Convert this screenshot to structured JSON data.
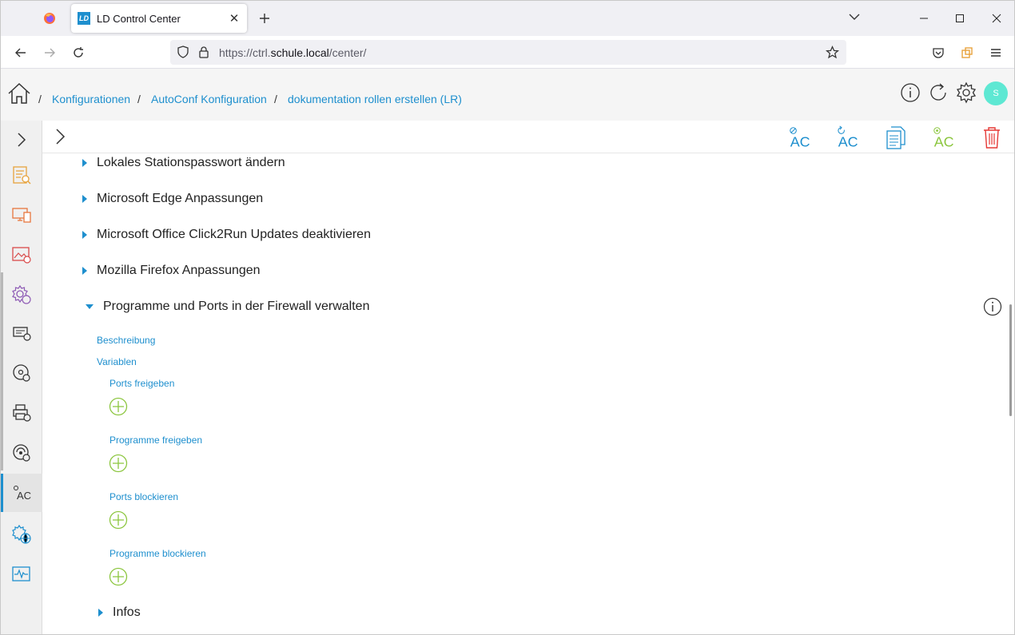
{
  "browser": {
    "tab_title": "LD Control Center",
    "tab_logo": "LD",
    "url_prefix": "https://ctrl.",
    "url_host": "schule.local",
    "url_path": "/center/"
  },
  "breadcrumb": [
    {
      "label": "Konfigurationen"
    },
    {
      "label": "AutoConf Konfiguration"
    },
    {
      "label": "dokumentation rollen erstellen (LR)"
    }
  ],
  "breadcrumb_separator": "/",
  "avatar_initial": "S",
  "toolbar_icons": [
    "clear-ac-icon",
    "reload-ac-icon",
    "document-icon",
    "add-ac-icon",
    "trash-icon"
  ],
  "sidebar_icons": [
    "reports-icon",
    "devices-icon",
    "images-icon",
    "configurations-icon",
    "network-devices-icon",
    "software-icon",
    "printers-icon",
    "drivers-icon",
    "autoconf-icon",
    "web-settings-icon",
    "monitoring-icon"
  ],
  "sections": {
    "s1": "Lokales Stationspasswort ändern",
    "s2": "Microsoft Edge Anpassungen",
    "s3": "Microsoft Office Click2Run Updates deaktivieren",
    "s4": "Mozilla Firefox Anpassungen",
    "s5": "Programme und Ports in der Firewall verwalten",
    "s6": "Infos"
  },
  "expanded": {
    "beschreibung": "Beschreibung",
    "variablen": "Variablen",
    "var1": "Ports freigeben",
    "var2": "Programme freigeben",
    "var3": "Ports blockieren",
    "var4": "Programme blockieren"
  },
  "colors": {
    "accent": "#1e8fce",
    "add_green": "#8cc63f",
    "delete_red": "#e53935",
    "avatar": "#5ee8d3"
  }
}
